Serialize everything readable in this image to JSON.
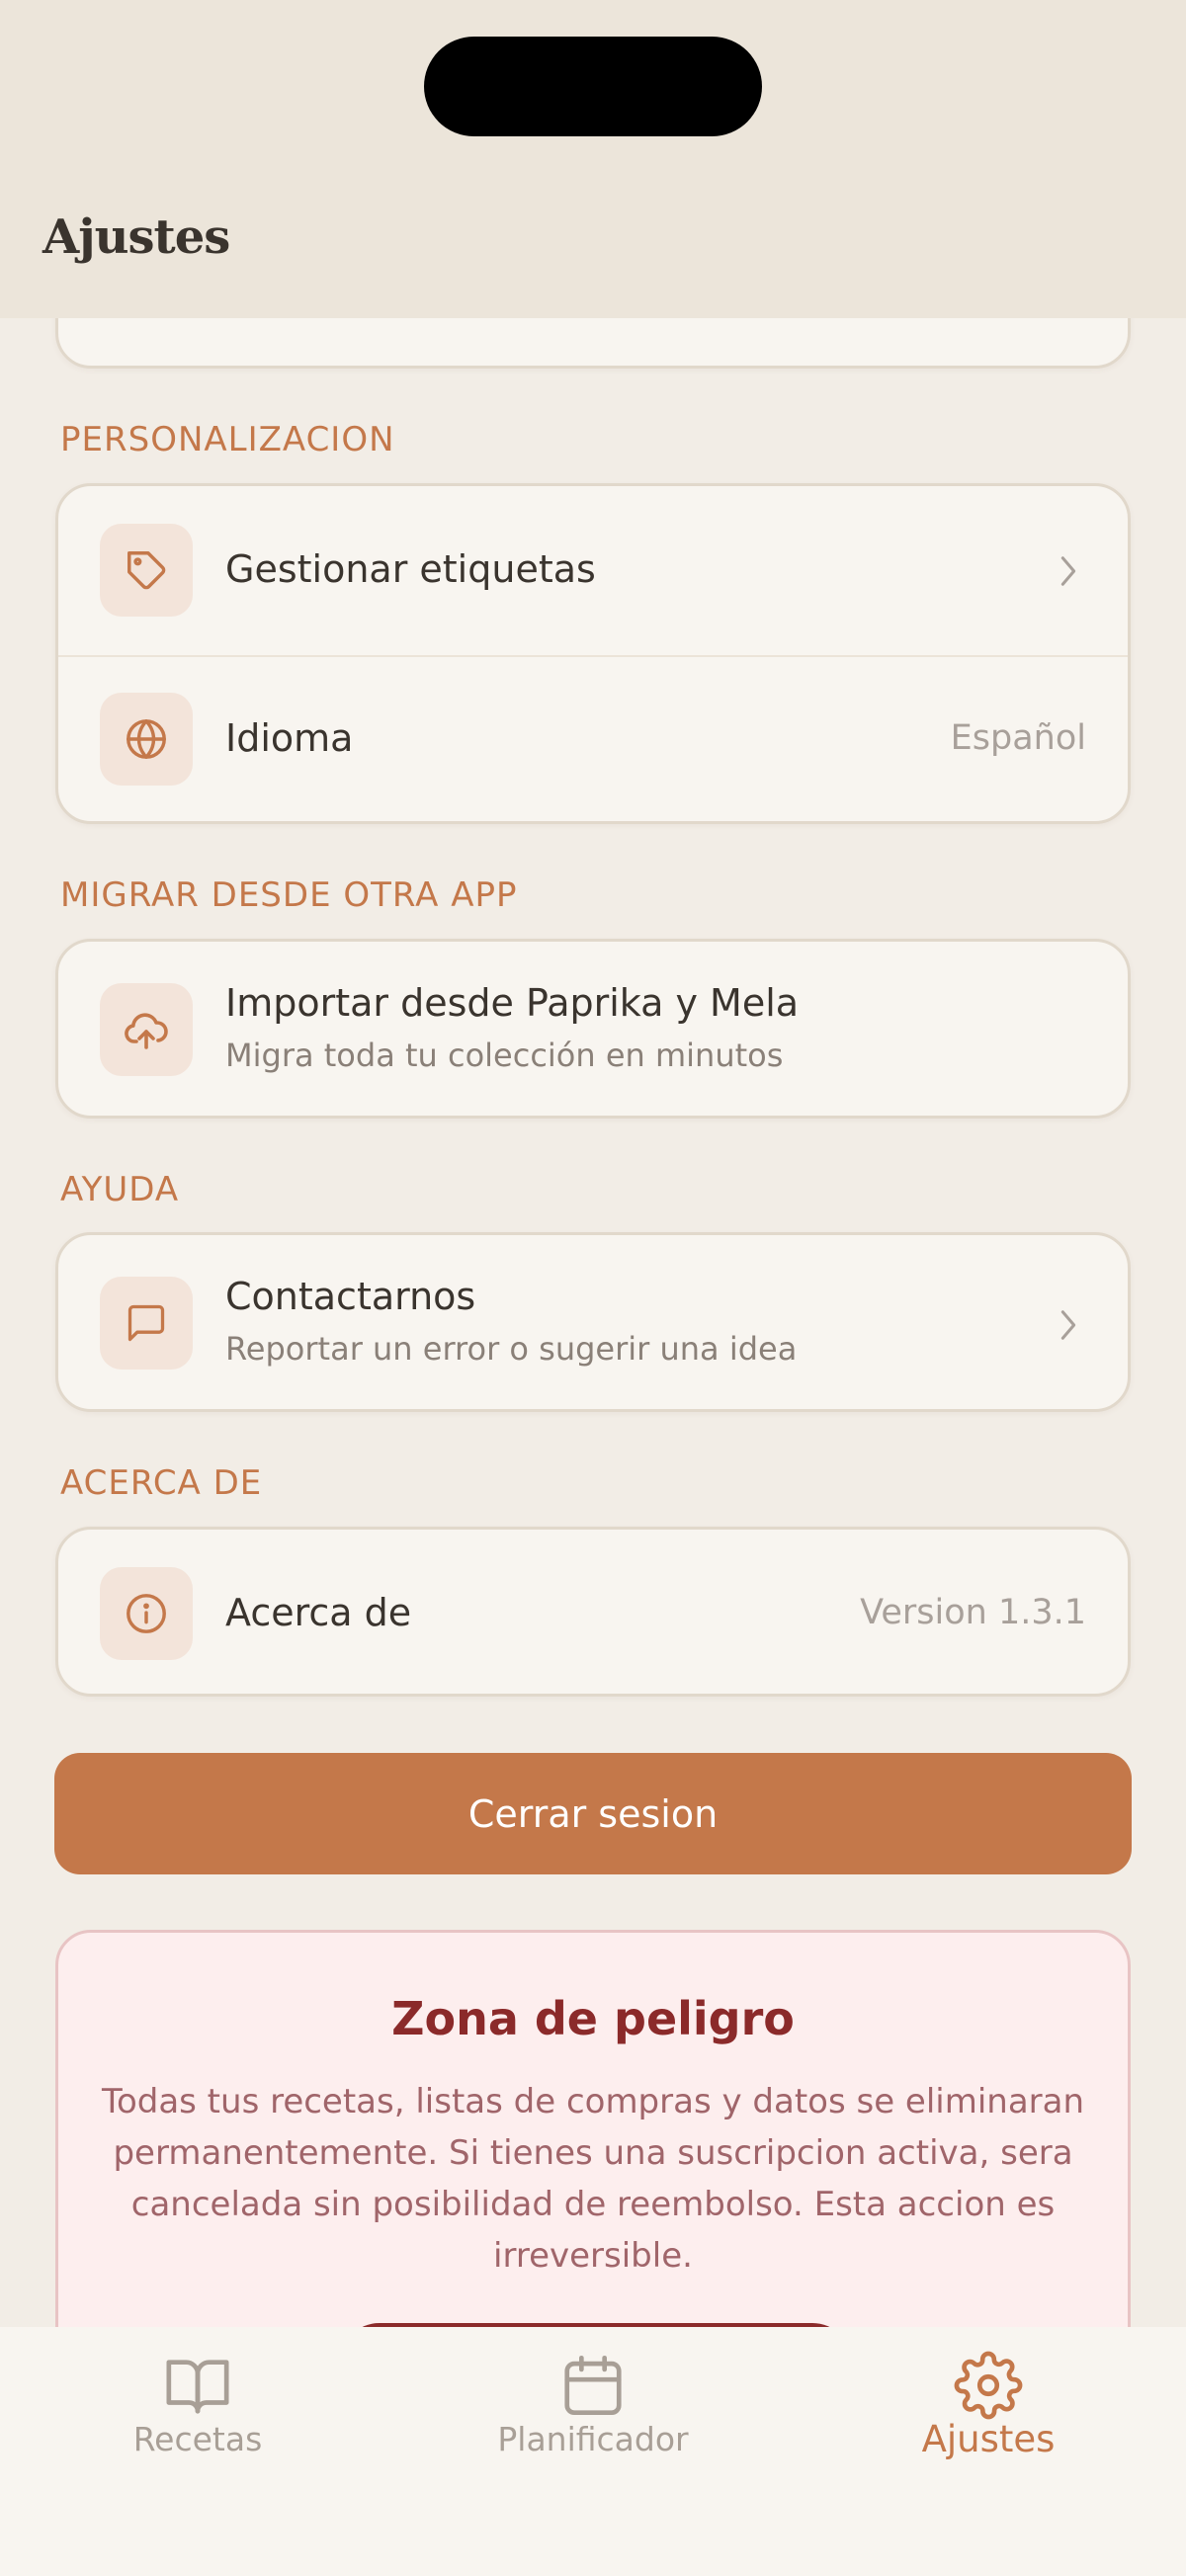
{
  "header": {
    "title": "Ajustes"
  },
  "sections": {
    "personalization": {
      "label": "PERSONALIZACION",
      "items": [
        {
          "title": "Gestionar etiquetas",
          "icon": "tag-icon"
        },
        {
          "title": "Idioma",
          "value": "Español",
          "icon": "globe-icon"
        }
      ]
    },
    "migrate": {
      "label": "MIGRAR DESDE OTRA APP",
      "items": [
        {
          "title": "Importar desde Paprika y Mela",
          "subtitle": "Migra toda tu colección en minutos",
          "icon": "cloud-upload-icon"
        }
      ]
    },
    "help": {
      "label": "AYUDA",
      "items": [
        {
          "title": "Contactarnos",
          "subtitle": "Reportar un error o sugerir una idea",
          "icon": "message-icon"
        }
      ]
    },
    "about": {
      "label": "ACERCA DE",
      "items": [
        {
          "title": "Acerca de",
          "value": "Version 1.3.1",
          "icon": "info-icon"
        }
      ]
    }
  },
  "logout": {
    "label": "Cerrar sesion"
  },
  "danger_zone": {
    "title": "Zona de peligro",
    "text": "Todas tus recetas, listas de compras y datos se eliminaran permanentemente. Si tienes una suscripcion activa, sera cancelada sin posibilidad de reembolso. Esta accion es irreversible."
  },
  "tabbar": {
    "tabs": [
      {
        "label": "Recetas",
        "icon": "book-icon",
        "active": false
      },
      {
        "label": "Planificador",
        "icon": "calendar-icon",
        "active": false
      },
      {
        "label": "Ajustes",
        "icon": "gear-icon",
        "active": true
      }
    ]
  },
  "colors": {
    "accent": "#c4784a",
    "danger": "#8b2a2a",
    "background": "#f2ede6",
    "card": "#f8f5f0"
  }
}
